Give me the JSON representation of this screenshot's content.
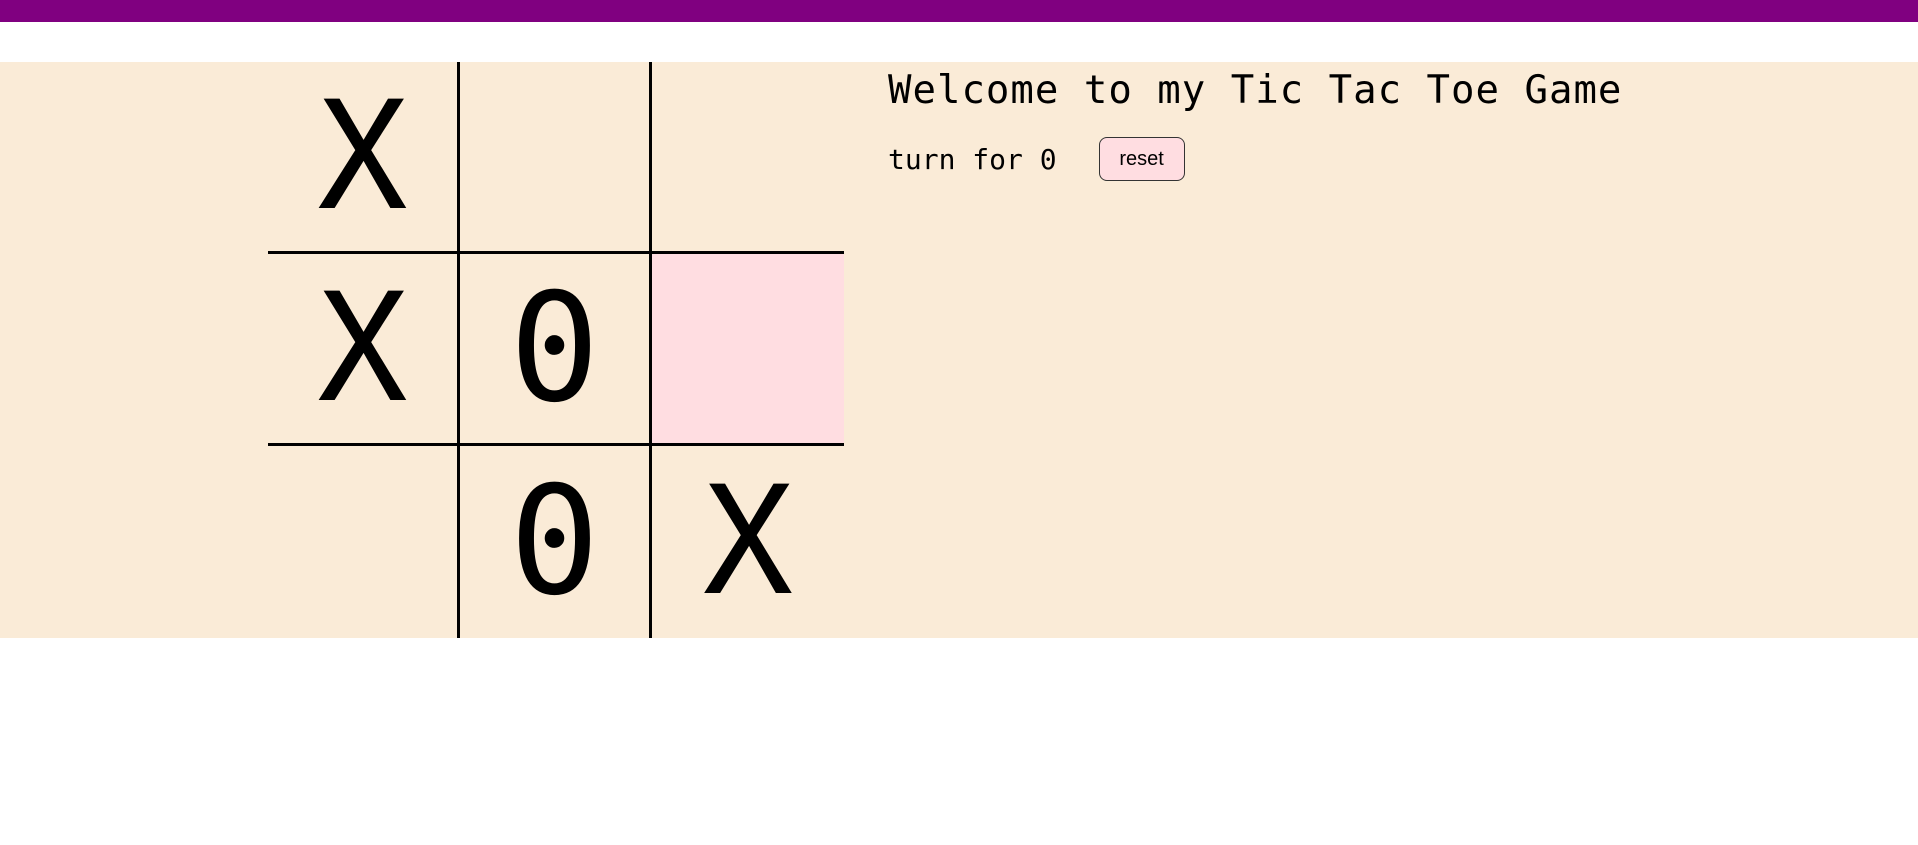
{
  "header": {
    "bar_color": "#800080"
  },
  "game": {
    "title": "Welcome to my Tic Tac Toe Game",
    "turn_text": "turn for 0",
    "reset_label": "reset",
    "background_color": "#faebd7",
    "hover_color": "#ffdde1",
    "board": [
      [
        "X",
        "",
        ""
      ],
      [
        "X",
        "0",
        ""
      ],
      [
        "",
        "0",
        "X"
      ]
    ],
    "hovered_cell": {
      "row": 1,
      "col": 2
    }
  }
}
